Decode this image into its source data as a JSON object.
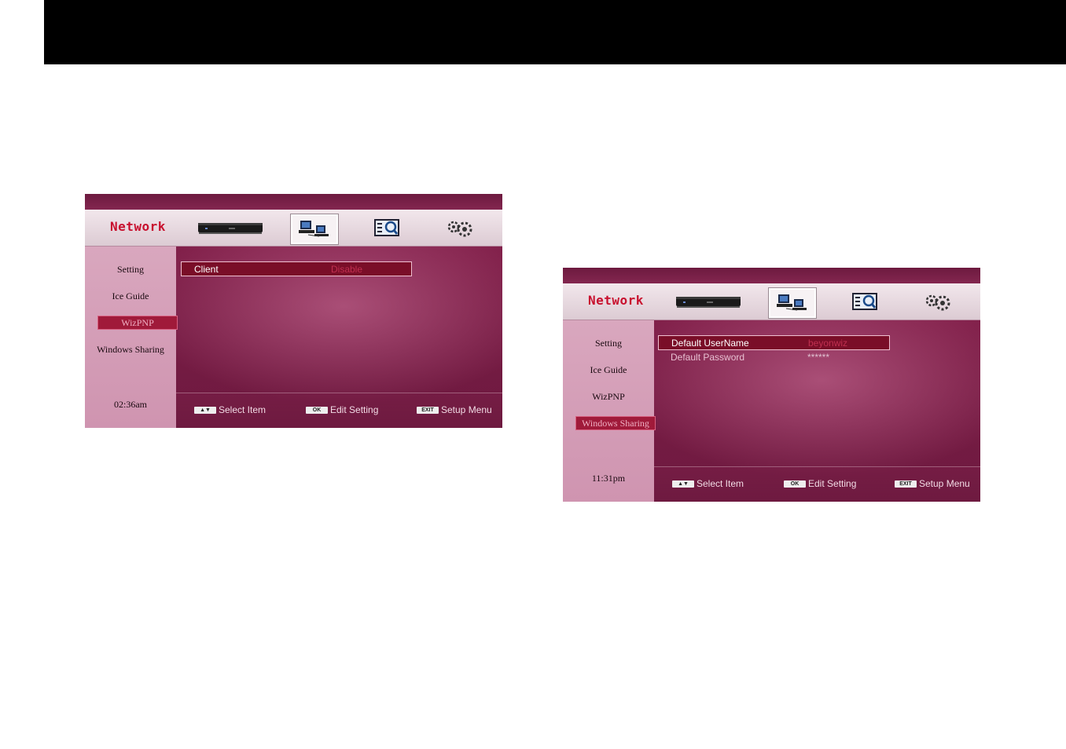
{
  "screens": [
    {
      "title": "Network",
      "sidebar": [
        "Setting",
        "Ice Guide",
        "WizPNP",
        "Windows Sharing"
      ],
      "active_sidebar": "WizPNP",
      "rows": [
        {
          "label": "Client",
          "value": "Disable",
          "selected": true
        }
      ],
      "time": "02:36am",
      "hints": [
        {
          "key": "▲▼",
          "label": "Select Item"
        },
        {
          "key": "OK",
          "label": "Edit Setting"
        },
        {
          "key": "EXIT",
          "label": "Setup Menu"
        }
      ]
    },
    {
      "title": "Network",
      "sidebar": [
        "Setting",
        "Ice Guide",
        "WizPNP",
        "Windows Sharing"
      ],
      "active_sidebar": "Windows Sharing",
      "rows": [
        {
          "label": "Default UserName",
          "value": "beyonwiz",
          "selected": true
        },
        {
          "label": "Default Password",
          "value": "******",
          "selected": false
        }
      ],
      "time": "11:31pm",
      "hints": [
        {
          "key": "▲▼",
          "label": "Select Item"
        },
        {
          "key": "OK",
          "label": "Edit Setting"
        },
        {
          "key": "EXIT",
          "label": "Setup Menu"
        }
      ]
    }
  ],
  "icons": [
    "receiver-icon",
    "network-icon",
    "search-icon",
    "gear-icon"
  ],
  "colors": {
    "accent": "#c8102e",
    "highlight": "#7a0e28",
    "background": "#7a1c45"
  }
}
